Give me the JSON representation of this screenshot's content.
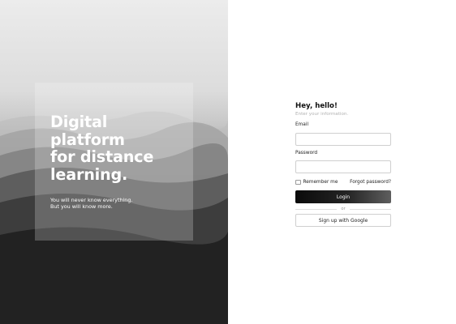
{
  "hero": {
    "title_lines": [
      "Digital",
      "platform",
      "for distance",
      "learning."
    ],
    "subtitle_lines": [
      "You will never know everything.",
      "But you will know more."
    ]
  },
  "form": {
    "greeting": "Hey, hello!",
    "subtitle": "Enter your information.",
    "email_label": "Email",
    "email_value": "",
    "password_label": "Password",
    "password_value": "",
    "remember_label": "Remember me",
    "remember_checked": false,
    "forgot_label": "Forgot password?",
    "login_label": "Login",
    "divider_label": "or",
    "google_label": "Sign up with Google"
  },
  "colors": {
    "button_dark": "#111111",
    "text_primary": "#111111",
    "text_muted": "#b2b2b2",
    "border": "#cfcfcf"
  }
}
